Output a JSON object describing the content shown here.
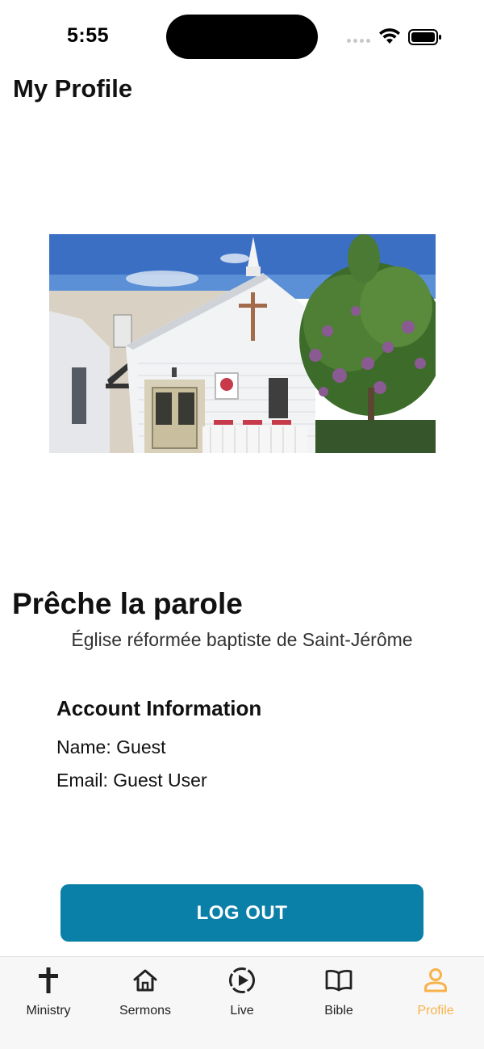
{
  "status_bar": {
    "time": "5:55"
  },
  "header": {
    "title": "My Profile"
  },
  "church": {
    "name": "Prêche la parole",
    "subtitle": "Église réformée baptiste de Saint-Jérôme"
  },
  "account": {
    "heading": "Account Information",
    "name_line": "Name: Guest",
    "email_line": "Email: Guest User"
  },
  "actions": {
    "logout_label": "LOG OUT"
  },
  "tab_bar": {
    "items": [
      {
        "label": "Ministry",
        "icon": "cross-icon"
      },
      {
        "label": "Sermons",
        "icon": "home-icon"
      },
      {
        "label": "Live",
        "icon": "play-circle-icon"
      },
      {
        "label": "Bible",
        "icon": "book-icon"
      },
      {
        "label": "Profile",
        "icon": "person-icon"
      }
    ],
    "active_color": "#f8b24a",
    "inactive_color": "#222222"
  },
  "colors": {
    "button": "#0a7fa8"
  }
}
